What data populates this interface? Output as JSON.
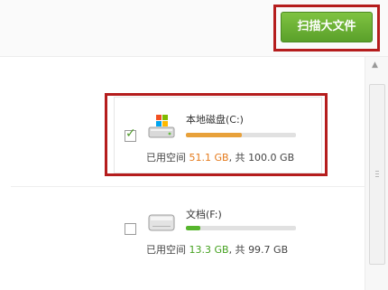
{
  "toolbar": {
    "scan_button_label": "扫描大文件"
  },
  "drives": [
    {
      "name": "本地磁盘(C:)",
      "checked": true,
      "used_label": "已用空间",
      "used": "51.1 GB",
      "total_label": ", 共",
      "total": "100.0 GB",
      "fill_fraction": 0.51,
      "fill_color": "#e8a13a"
    },
    {
      "name": "文档(F:)",
      "checked": false,
      "used_label": "已用空间",
      "used": "13.3 GB",
      "total_label": ", 共",
      "total": "99.7 GB",
      "fill_fraction": 0.13,
      "fill_color": "#56b52c"
    }
  ],
  "colors": {
    "accent_green": "#5aa02a",
    "highlight_red": "#b51d1d",
    "used_orange": "#e57a1b",
    "used_green": "#44a11f"
  },
  "icons": {
    "system_drive": "windows-drive-icon",
    "data_drive": "hard-drive-icon",
    "check": "check-icon"
  }
}
